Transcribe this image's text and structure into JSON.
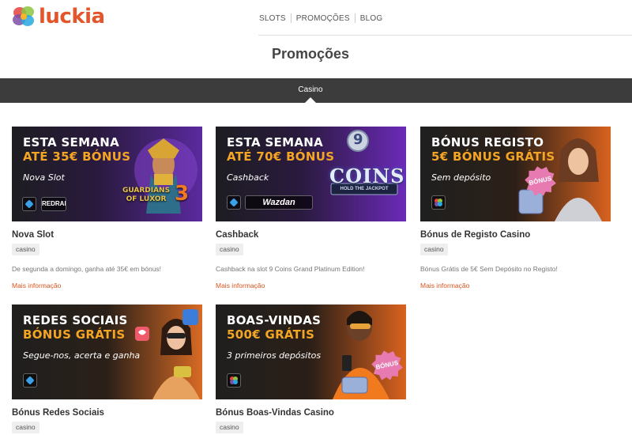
{
  "brand": {
    "name": "luckia",
    "accent": "#e3552a",
    "link_color": "#d9551f"
  },
  "nav": {
    "items": [
      "SLOTS",
      "PROMOÇÕES",
      "BLOG"
    ]
  },
  "page": {
    "title": "Promoções"
  },
  "tabs": {
    "active": "Casino"
  },
  "cards": [
    {
      "banner": {
        "line1": "ESTA SEMANA",
        "line2": "ATÉ 35€ BÓNUS",
        "sub": "Nova Slot",
        "art_text": "GUARDIANS OF LUXOR",
        "art_num": "3",
        "provider": "REDRAKE"
      },
      "title": "Nova Slot",
      "tag": "casino",
      "desc": "De segunda a domingo, ganha até 35€ em bónus!",
      "more": "Mais informação"
    },
    {
      "banner": {
        "line1": "ESTA SEMANA",
        "line2": "ATÉ 70€ BÓNUS",
        "sub": "Cashback",
        "art_text": "COINS",
        "art_num": "9",
        "art_caption": "HOLD THE JACKPOT",
        "provider": "Wazdan"
      },
      "title": "Cashback",
      "tag": "casino",
      "desc": "Cashback na slot 9 Coins Grand Platinum Edition!",
      "more": "Mais informação"
    },
    {
      "banner": {
        "line1": "BÓNUS REGISTO",
        "line2": "5€ BÓNUS GRÁTIS",
        "sub": "Sem depósito",
        "bubble": "BÓNUS"
      },
      "title": "Bónus de Registo Casino",
      "tag": "casino",
      "desc": "Bónus Grátis de 5€ Sem Depósito no Registo!",
      "more": "Mais informação"
    },
    {
      "banner": {
        "line1": "REDES SOCIAIS",
        "line2": "BÓNUS GRÁTIS",
        "sub": "Segue-nos, acerta e ganha"
      },
      "title": "Bónus Redes Sociais",
      "tag": "casino"
    },
    {
      "banner": {
        "line1": "BOAS-VINDAS",
        "line2": "500€ GRÁTIS",
        "sub": "3 primeiros depósitos",
        "bubble": "BÓNUS"
      },
      "title": "Bónus Boas-Vindas Casino",
      "tag": "casino"
    }
  ]
}
